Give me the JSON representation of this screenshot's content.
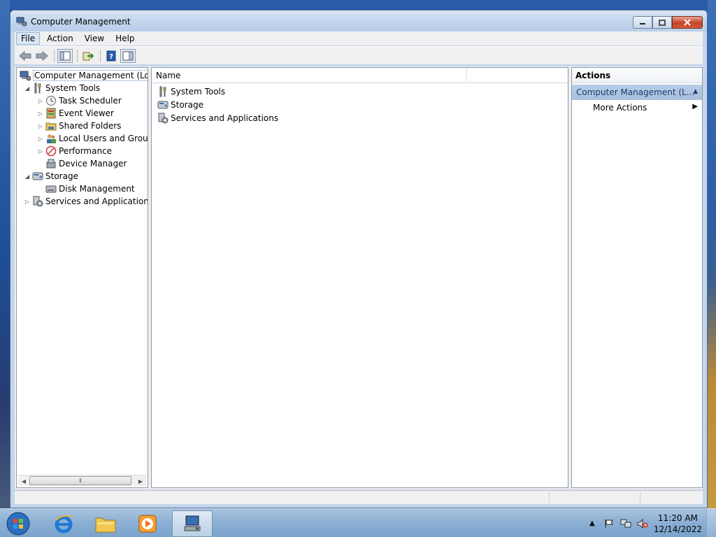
{
  "window": {
    "title": "Computer Management"
  },
  "menu": [
    {
      "label": "File",
      "accel": "F"
    },
    {
      "label": "Action",
      "accel": "A"
    },
    {
      "label": "View",
      "accel": "V"
    },
    {
      "label": "Help",
      "accel": "H"
    }
  ],
  "tree": {
    "root": "Computer Management (Local",
    "system_tools": "System Tools",
    "task_scheduler": "Task Scheduler",
    "event_viewer": "Event Viewer",
    "shared_folders": "Shared Folders",
    "local_users": "Local Users and Groups",
    "performance": "Performance",
    "device_manager": "Device Manager",
    "storage": "Storage",
    "disk_management": "Disk Management",
    "services": "Services and Applications"
  },
  "list": {
    "column_name": "Name",
    "items": [
      "System Tools",
      "Storage",
      "Services and Applications"
    ]
  },
  "actions": {
    "header": "Actions",
    "section": "Computer Management (L...",
    "more_actions": "More Actions"
  },
  "taskbar": {
    "time": "11:20 AM",
    "date": "12/14/2022"
  },
  "colors": {
    "selection_section": "#a7c0df",
    "titlebar": "#c1d5ee"
  }
}
